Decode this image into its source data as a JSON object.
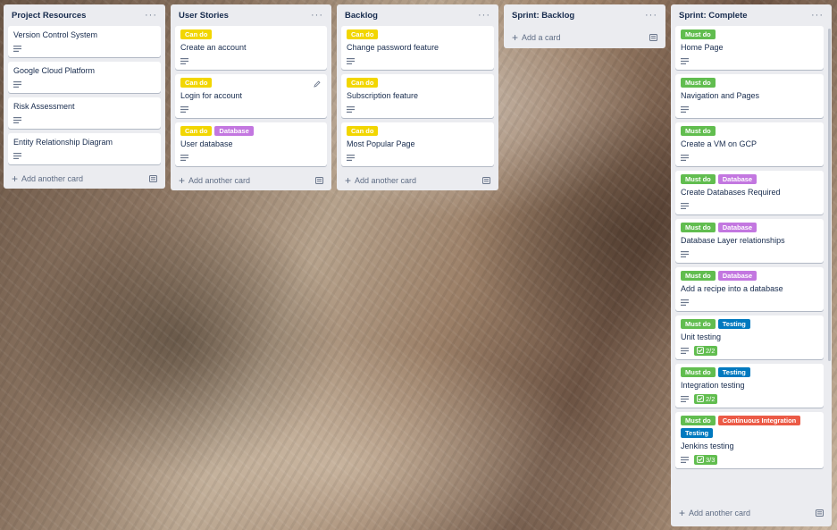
{
  "colors": {
    "can_do": "#f2d600",
    "must_do": "#61bd4f",
    "database": "#c377e0",
    "testing": "#0079bf",
    "continuous_integration": "#eb5a46",
    "checklist_complete": "#61bd4f"
  },
  "icons": {
    "list_menu": "ellipsis-icon",
    "description": "description-icon",
    "add": "plus-icon",
    "template": "card-template-icon",
    "checklist": "checkbox-icon",
    "edit": "pencil-icon"
  },
  "lists": [
    {
      "title": "Project Resources",
      "cards": [
        {
          "title": "Version Control System"
        },
        {
          "title": "Google Cloud Platform"
        },
        {
          "title": "Risk Assessment"
        },
        {
          "title": "Entity Relationship Diagram"
        }
      ],
      "add_label": "Add another card"
    },
    {
      "title": "User Stories",
      "cards": [
        {
          "labels": [
            "Can do"
          ],
          "title": "Create an account"
        },
        {
          "labels": [
            "Can do"
          ],
          "title": "Login for account"
        },
        {
          "labels": [
            "Can do",
            "Database"
          ],
          "title": "User database"
        }
      ],
      "add_label": "Add another card"
    },
    {
      "title": "Backlog",
      "cards": [
        {
          "labels": [
            "Can do"
          ],
          "title": "Change password feature"
        },
        {
          "labels": [
            "Can do"
          ],
          "title": "Subscription feature"
        },
        {
          "labels": [
            "Can do"
          ],
          "title": "Most Popular Page"
        }
      ],
      "add_label": "Add another card"
    },
    {
      "title": "Sprint: Backlog",
      "cards": [],
      "add_label": "Add a card"
    },
    {
      "title": "Sprint: Complete",
      "cards": [
        {
          "labels": [
            "Must do"
          ],
          "title": "Home Page"
        },
        {
          "labels": [
            "Must do"
          ],
          "title": "Navigation and Pages"
        },
        {
          "labels": [
            "Must do"
          ],
          "title": "Create a VM on GCP"
        },
        {
          "labels": [
            "Must do",
            "Database"
          ],
          "title": "Create Databases Required"
        },
        {
          "labels": [
            "Must do",
            "Database"
          ],
          "title": "Database Layer relationships"
        },
        {
          "labels": [
            "Must do",
            "Database"
          ],
          "title": "Add a recipe into a database"
        },
        {
          "labels": [
            "Must do",
            "Testing"
          ],
          "title": "Unit testing",
          "checklist": "2/2"
        },
        {
          "labels": [
            "Must do",
            "Testing"
          ],
          "title": "Integration testing",
          "checklist": "2/2"
        },
        {
          "labels": [
            "Must do",
            "Continuous Integration",
            "Testing"
          ],
          "title": "Jenkins testing",
          "checklist": "3/3"
        }
      ],
      "add_label": "Add another card"
    }
  ]
}
